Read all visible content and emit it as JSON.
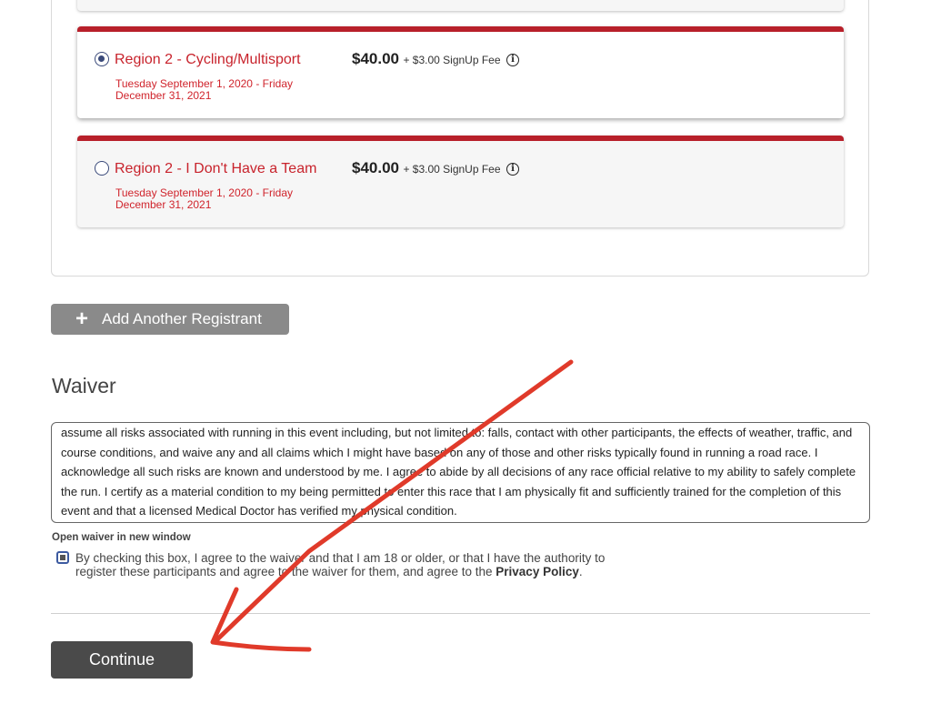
{
  "registration_options": [
    {
      "title": "Region 2 - Cycling/Multisport",
      "dates": "Tuesday September 1, 2020 - Friday December 31, 2021",
      "price": "$40.00",
      "fee": "+ $3.00 SignUp Fee",
      "selected": true
    },
    {
      "title": "Region 2 - I Don't Have a Team",
      "dates": "Tuesday September 1, 2020 - Friday December 31, 2021",
      "price": "$40.00",
      "fee": "+ $3.00 SignUp Fee",
      "selected": false
    }
  ],
  "add_registrant": {
    "icon": "plus-icon",
    "label": "Add Another Registrant"
  },
  "waiver": {
    "heading": "Waiver",
    "text": "assume all risks associated with running in this event including, but not limited to: falls, contact with other participants, the effects of weather, traffic, and course conditions, and waive any and all claims which I might have based on any of those and other risks typically found in running a road race. I acknowledge all such risks are known and understood by me. I agree to abide by all decisions of any race official relative to my ability to safely complete the run. I certify as a material condition to my being permitted to enter this race that I am physically fit and sufficiently trained for the completion of this event and that a licensed Medical Doctor has verified my physical condition.",
    "open_link": "Open waiver in new window",
    "agree_text": "By checking this box, I agree to the waiver and that I am 18 or older, or that I have the authority to register these participants and agree to the waiver for them, and agree to the ",
    "privacy_link": "Privacy Policy",
    "agree_suffix": ".",
    "agree_checked": true
  },
  "continue_label": "Continue",
  "colors": {
    "accent_red": "#b8202a",
    "title_red": "#c8232c",
    "annotation_arrow": "#e03a2a",
    "continue_bg": "#4a4a4a",
    "add_button_bg": "#8a8a8a"
  }
}
